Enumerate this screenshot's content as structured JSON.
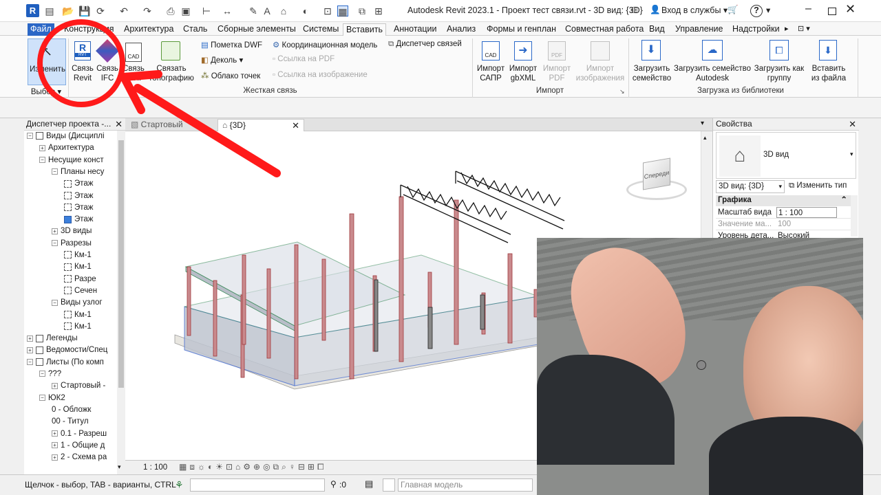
{
  "app": {
    "logo_letter": "R",
    "title": "Autodesk Revit 2023.1 - Проект тест связи.rvt - 3D вид: {3D}",
    "signin": "Вход в службы",
    "help": "?",
    "window_controls": [
      "minimize-icon",
      "maximize-icon",
      "close-icon"
    ]
  },
  "ribbon_tabs": [
    {
      "label": "Файл",
      "kind": "file"
    },
    {
      "label": "Конструкция"
    },
    {
      "label": "Архитектура"
    },
    {
      "label": "Сталь"
    },
    {
      "label": "Сборные элементы"
    },
    {
      "label": "Системы"
    },
    {
      "label": "Вставить",
      "active": true
    },
    {
      "label": "Аннотации"
    },
    {
      "label": "Анализ"
    },
    {
      "label": "Формы и генплан"
    },
    {
      "label": "Совместная работа"
    },
    {
      "label": "Вид"
    },
    {
      "label": "Управление"
    },
    {
      "label": "Надстройки"
    }
  ],
  "ribbon": {
    "modify": {
      "label": "Изменить",
      "panel": "Выбор"
    },
    "link_revit": {
      "line1": "Связь",
      "line2": "Revit"
    },
    "link_ifc": {
      "line1": "Связь",
      "line2": "IFC"
    },
    "link_cad": {
      "line1": "Связь",
      "line2": "САПР"
    },
    "link_topo": {
      "line1": "Связать",
      "line2": "топографию"
    },
    "small_link": [
      {
        "label": "Пометка DWF",
        "icon": "dwf-markup-icon",
        "enabled": true
      },
      {
        "label": "Деколь",
        "icon": "decal-icon",
        "enabled": true
      },
      {
        "label": "Облако точек",
        "icon": "point-cloud-icon",
        "enabled": true
      }
    ],
    "small_link2": [
      {
        "label": "Координационная модель",
        "icon": "coordination-model-icon",
        "enabled": true
      },
      {
        "label": "Ссылка на PDF",
        "icon": "pdf-link-icon",
        "enabled": false
      },
      {
        "label": "Ссылка на изображение",
        "icon": "image-link-icon",
        "enabled": false
      }
    ],
    "link_manager": "Диспетчер связей",
    "link_panel_title": "Жесткая связь",
    "import_items": [
      {
        "line1": "Импорт",
        "line2": "САПР",
        "enabled": true,
        "icon": "import-cad-icon"
      },
      {
        "line1": "Импорт",
        "line2": "gbXML",
        "enabled": true,
        "icon": "import-gbxml-icon"
      },
      {
        "line1": "Импорт",
        "line2": "PDF",
        "enabled": false,
        "icon": "import-pdf-icon"
      },
      {
        "line1": "Импорт",
        "line2": "изображения",
        "enabled": false,
        "icon": "import-image-icon"
      }
    ],
    "import_panel_title": "Импорт",
    "library_items": [
      {
        "line1": "Загрузить",
        "line2": "семейство",
        "icon": "load-family-icon"
      },
      {
        "line1": "Загрузить семейство",
        "line2": "Autodesk",
        "icon": "load-autodesk-family-icon"
      },
      {
        "line1": "Загрузить как",
        "line2": "группу",
        "icon": "load-as-group-icon"
      },
      {
        "line1": "Вставить",
        "line2": "из файла",
        "icon": "insert-from-file-icon"
      }
    ],
    "library_panel_title": "Загрузка из библиотеки"
  },
  "browser": {
    "title": "Диспетчер проекта -...",
    "items": [
      {
        "label": "Виды (Дисциплі",
        "level": 0,
        "exp": "-",
        "icon": "views-icon"
      },
      {
        "label": "Архитектура",
        "level": 1,
        "exp": "+"
      },
      {
        "label": "Несущие конст",
        "level": 1,
        "exp": "-"
      },
      {
        "label": "Планы несу",
        "level": 2,
        "exp": "-"
      },
      {
        "label": "Этаж",
        "level": 3,
        "view": true
      },
      {
        "label": "Этаж",
        "level": 3,
        "view": true
      },
      {
        "label": "Этаж",
        "level": 3,
        "view": true
      },
      {
        "label": "Этаж",
        "level": 3,
        "view": true,
        "selected": true
      },
      {
        "label": "3D виды",
        "level": 2,
        "exp": "+"
      },
      {
        "label": "Разрезы",
        "level": 2,
        "exp": "-"
      },
      {
        "label": "Км-1",
        "level": 3,
        "view": true
      },
      {
        "label": "Км-1",
        "level": 3,
        "view": true
      },
      {
        "label": "Разре",
        "level": 3,
        "view": true
      },
      {
        "label": "Сечен",
        "level": 3,
        "view": true
      },
      {
        "label": "Виды узлог",
        "level": 2,
        "exp": "-"
      },
      {
        "label": "Км-1",
        "level": 3,
        "view": true
      },
      {
        "label": "Км-1",
        "level": 3,
        "view": true
      },
      {
        "label": "Легенды",
        "level": 0,
        "exp": "+",
        "icon": "legends-icon"
      },
      {
        "label": "Ведомости/Спец",
        "level": 0,
        "exp": "+",
        "icon": "schedules-icon"
      },
      {
        "label": "Листы (По комп",
        "level": 0,
        "exp": "-",
        "icon": "sheets-icon"
      },
      {
        "label": "???",
        "level": 1,
        "exp": "-"
      },
      {
        "label": "Стартовый -",
        "level": 2,
        "exp": "+"
      },
      {
        "label": "ЮК2",
        "level": 1,
        "exp": "-"
      },
      {
        "label": "0 - Обложк",
        "level": 2
      },
      {
        "label": "00 - Титул",
        "level": 2
      },
      {
        "label": "0.1 - Разреш",
        "level": 2,
        "exp": "+"
      },
      {
        "label": "1 - Общие д",
        "level": 2,
        "exp": "+"
      },
      {
        "label": "2 - Схема ра",
        "level": 2,
        "exp": "+"
      }
    ]
  },
  "view_tabs": [
    {
      "label": "Стартовый",
      "active": false
    },
    {
      "label": "{3D}",
      "active": true
    }
  ],
  "viewcube_label": "Спереди",
  "view_control": {
    "scale": "1 : 100"
  },
  "status": {
    "hint": "Щелчок - выбор, TAB - варианты, CTRL",
    "filter_count": ":0",
    "model": "Главная модель"
  },
  "properties": {
    "title": "Свойства",
    "type_name": "3D вид",
    "selector": "3D вид: {3D}",
    "edit_type": "Изменить тип",
    "group": "Графика",
    "rows": [
      {
        "name": "Масштаб вида",
        "value": "1 : 100",
        "enabled": true
      },
      {
        "name": "Значение ма...",
        "value": "100",
        "enabled": false
      },
      {
        "name": "Уровень дета...",
        "value": "Высокий",
        "enabled": true
      }
    ]
  },
  "colors": {
    "annotation_red": "#ff1a1a",
    "revit_blue": "#1f5fbf",
    "column_red": "#c0474b",
    "slab_gray": "#c8ccd4"
  }
}
